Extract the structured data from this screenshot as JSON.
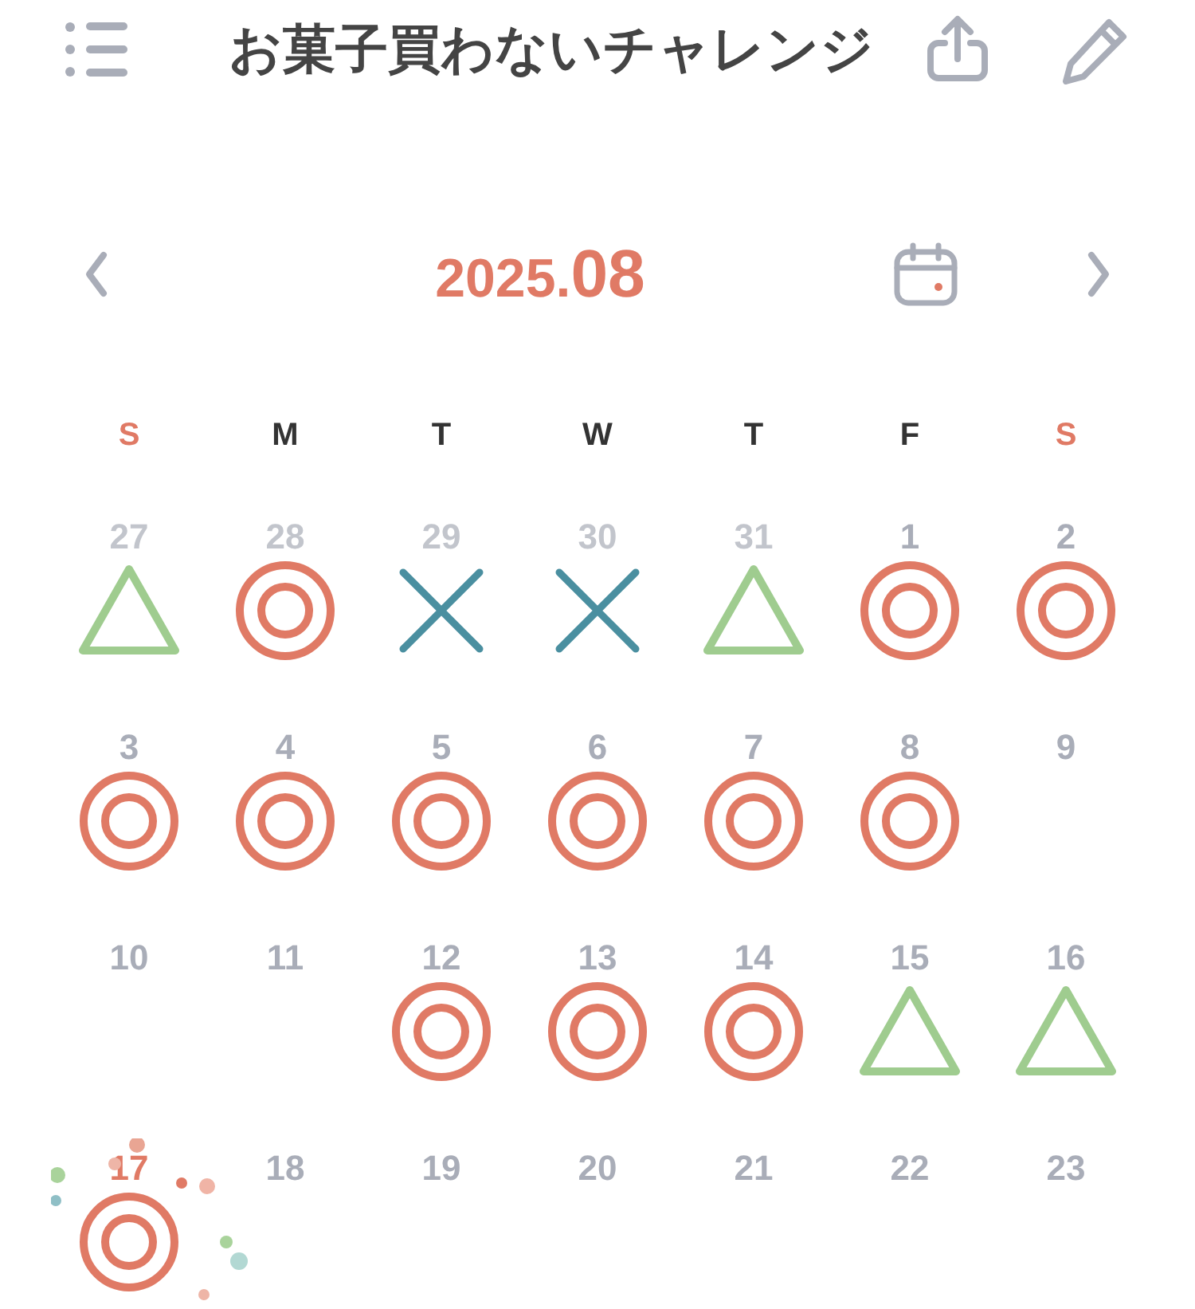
{
  "header": {
    "title": "お菓子買わないチャレンジ"
  },
  "month_nav": {
    "year": "2025.",
    "month": "08"
  },
  "weekdays": [
    {
      "label": "S",
      "holiday": true
    },
    {
      "label": "M",
      "holiday": false
    },
    {
      "label": "T",
      "holiday": false
    },
    {
      "label": "W",
      "holiday": false
    },
    {
      "label": "T",
      "holiday": false
    },
    {
      "label": "F",
      "holiday": false
    },
    {
      "label": "S",
      "holiday": true
    }
  ],
  "days": [
    {
      "day": "27",
      "outside": true,
      "today": false,
      "mark": {
        "kind": "triangle"
      }
    },
    {
      "day": "28",
      "outside": true,
      "today": false,
      "mark": {
        "kind": "double_circle"
      }
    },
    {
      "day": "29",
      "outside": true,
      "today": false,
      "mark": {
        "kind": "cross"
      }
    },
    {
      "day": "30",
      "outside": true,
      "today": false,
      "mark": {
        "kind": "cross"
      }
    },
    {
      "day": "31",
      "outside": true,
      "today": false,
      "mark": {
        "kind": "triangle"
      }
    },
    {
      "day": "1",
      "outside": false,
      "today": false,
      "mark": {
        "kind": "double_circle"
      }
    },
    {
      "day": "2",
      "outside": false,
      "today": false,
      "mark": {
        "kind": "double_circle"
      }
    },
    {
      "day": "3",
      "outside": false,
      "today": false,
      "mark": {
        "kind": "double_circle"
      }
    },
    {
      "day": "4",
      "outside": false,
      "today": false,
      "mark": {
        "kind": "double_circle"
      }
    },
    {
      "day": "5",
      "outside": false,
      "today": false,
      "mark": {
        "kind": "double_circle"
      }
    },
    {
      "day": "6",
      "outside": false,
      "today": false,
      "mark": {
        "kind": "double_circle"
      }
    },
    {
      "day": "7",
      "outside": false,
      "today": false,
      "mark": {
        "kind": "double_circle"
      }
    },
    {
      "day": "8",
      "outside": false,
      "today": false,
      "mark": {
        "kind": "double_circle"
      }
    },
    {
      "day": "9",
      "outside": false,
      "today": false
    },
    {
      "day": "10",
      "outside": false,
      "today": false
    },
    {
      "day": "11",
      "outside": false,
      "today": false
    },
    {
      "day": "12",
      "outside": false,
      "today": false,
      "mark": {
        "kind": "double_circle"
      }
    },
    {
      "day": "13",
      "outside": false,
      "today": false,
      "mark": {
        "kind": "double_circle"
      }
    },
    {
      "day": "14",
      "outside": false,
      "today": false,
      "mark": {
        "kind": "double_circle"
      }
    },
    {
      "day": "15",
      "outside": false,
      "today": false,
      "mark": {
        "kind": "triangle"
      }
    },
    {
      "day": "16",
      "outside": false,
      "today": false,
      "mark": {
        "kind": "triangle"
      }
    },
    {
      "day": "17",
      "outside": false,
      "today": true,
      "mark": {
        "kind": "double_circle"
      }
    },
    {
      "day": "18",
      "outside": false,
      "today": false
    },
    {
      "day": "19",
      "outside": false,
      "today": false
    },
    {
      "day": "20",
      "outside": false,
      "today": false
    },
    {
      "day": "21",
      "outside": false,
      "today": false
    },
    {
      "day": "22",
      "outside": false,
      "today": false
    },
    {
      "day": "23",
      "outside": false,
      "today": false
    }
  ]
}
